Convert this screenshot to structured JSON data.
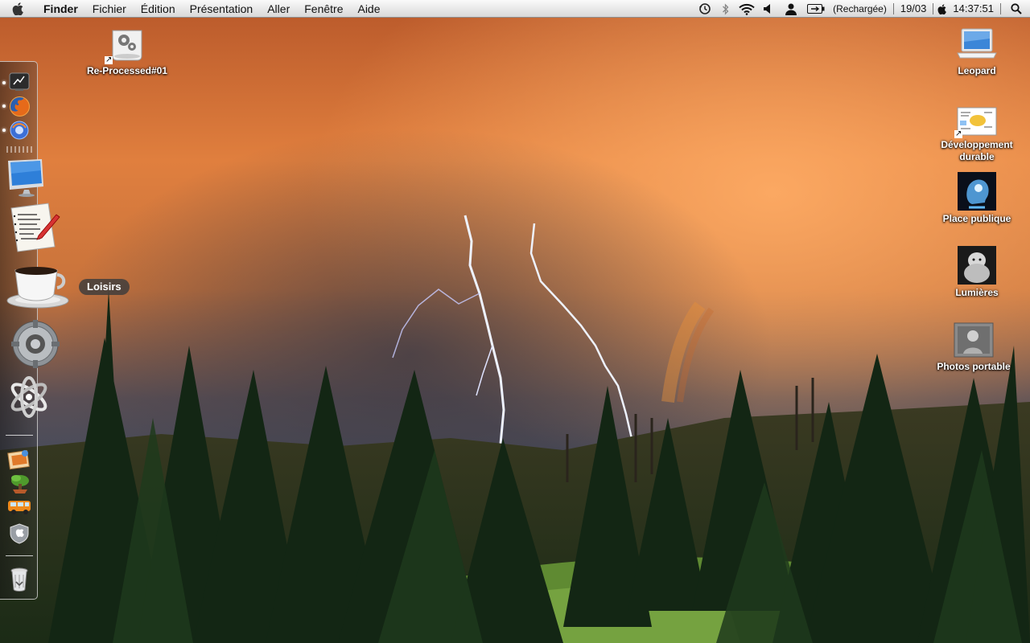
{
  "menubar": {
    "app_name": "Finder",
    "menus": [
      "Fichier",
      "Édition",
      "Présentation",
      "Aller",
      "Fenêtre",
      "Aide"
    ],
    "status": {
      "icons": [
        "time-machine-icon",
        "bluetooth-icon",
        "wifi-icon",
        "volume-icon",
        "user-icon",
        "battery-icon"
      ],
      "battery_label": "(Rechargée)",
      "date": "19/03",
      "time": "14:37:51"
    }
  },
  "dock": {
    "items": [
      {
        "name": "dashboard",
        "running": true
      },
      {
        "name": "firefox",
        "running": true
      },
      {
        "name": "vlc",
        "running": true
      },
      {
        "name": "imac"
      },
      {
        "name": "notepad"
      },
      {
        "name": "coffee-loisirs"
      },
      {
        "name": "system-preferences"
      },
      {
        "name": "atom"
      },
      {
        "name": "photo-app"
      },
      {
        "name": "bonsai"
      },
      {
        "name": "van"
      },
      {
        "name": "apple-shield"
      },
      {
        "name": "trash"
      }
    ],
    "tooltip": "Loisirs"
  },
  "desktop": {
    "icons": [
      {
        "label": "Re-Processed#01",
        "icon": "disk-image-icon"
      },
      {
        "label": "Leopard",
        "icon": "laptop-icon"
      },
      {
        "label": "Développement durable",
        "line1": "Développement",
        "line2": "durable",
        "icon": "document-icon"
      },
      {
        "label": "Place publique",
        "icon": "xray-head-icon"
      },
      {
        "label": "Lumières",
        "icon": "gorilla-photo-icon"
      },
      {
        "label": "Photos portable",
        "icon": "photo-album-icon"
      }
    ]
  },
  "colors": {
    "sky_top": "#d9793a",
    "sky_mid": "#f39a52",
    "storm": "#4f5060",
    "forest": "#1f3a1c",
    "meadow": "#6e9a3a"
  }
}
